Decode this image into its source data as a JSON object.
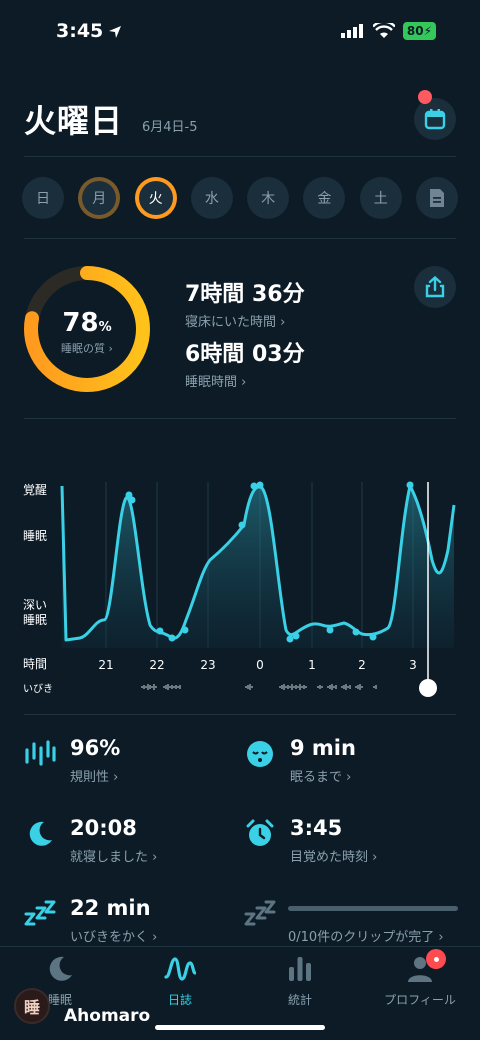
{
  "status": {
    "time": "3:45",
    "battery": "80"
  },
  "header": {
    "title": "火曜日",
    "date_range": "6月4日-5"
  },
  "week": [
    "日",
    "月",
    "火",
    "水",
    "木",
    "金",
    "土"
  ],
  "quality": {
    "percent": "78",
    "unit": "%",
    "label": "睡眠の質 ›",
    "fraction": 0.78
  },
  "summary": {
    "in_bed_value": "7時間 36分",
    "in_bed_label": "寝床にいた時間 ›",
    "sleep_value": "6時間 03分",
    "sleep_label": "睡眠時間 ›"
  },
  "graph": {
    "y_labels": {
      "awake": "覚醒",
      "sleep": "睡眠",
      "deep_1": "深い",
      "deep_2": "睡眠",
      "time": "時間",
      "snore": "いびき"
    },
    "x_ticks": [
      "21",
      "22",
      "23",
      "0",
      "1",
      "2",
      "3"
    ]
  },
  "stats": {
    "regularity": {
      "value": "96%",
      "label": "規則性 ›"
    },
    "to_sleep": {
      "value": "9 min",
      "label": "眠るまで ›"
    },
    "bedtime": {
      "value": "20:08",
      "label": "就寝しました ›"
    },
    "wake": {
      "value": "3:45",
      "label": "目覚めた時刻 ›"
    },
    "snoring": {
      "value": "22 min",
      "label": "いびきをかく ›"
    },
    "clips": {
      "label": "0/10件のクリップが完了 ›",
      "progress": 0
    }
  },
  "tabs": [
    {
      "label": "睡眠"
    },
    {
      "label": "日誌"
    },
    {
      "label": "統計"
    },
    {
      "label": "プロフィール"
    }
  ],
  "user": {
    "name": "Ahomaro",
    "badge": "睡"
  },
  "colors": {
    "accent": "#3ad0e6",
    "orange": "#ff9a1e",
    "background": "#0c1b26"
  }
}
